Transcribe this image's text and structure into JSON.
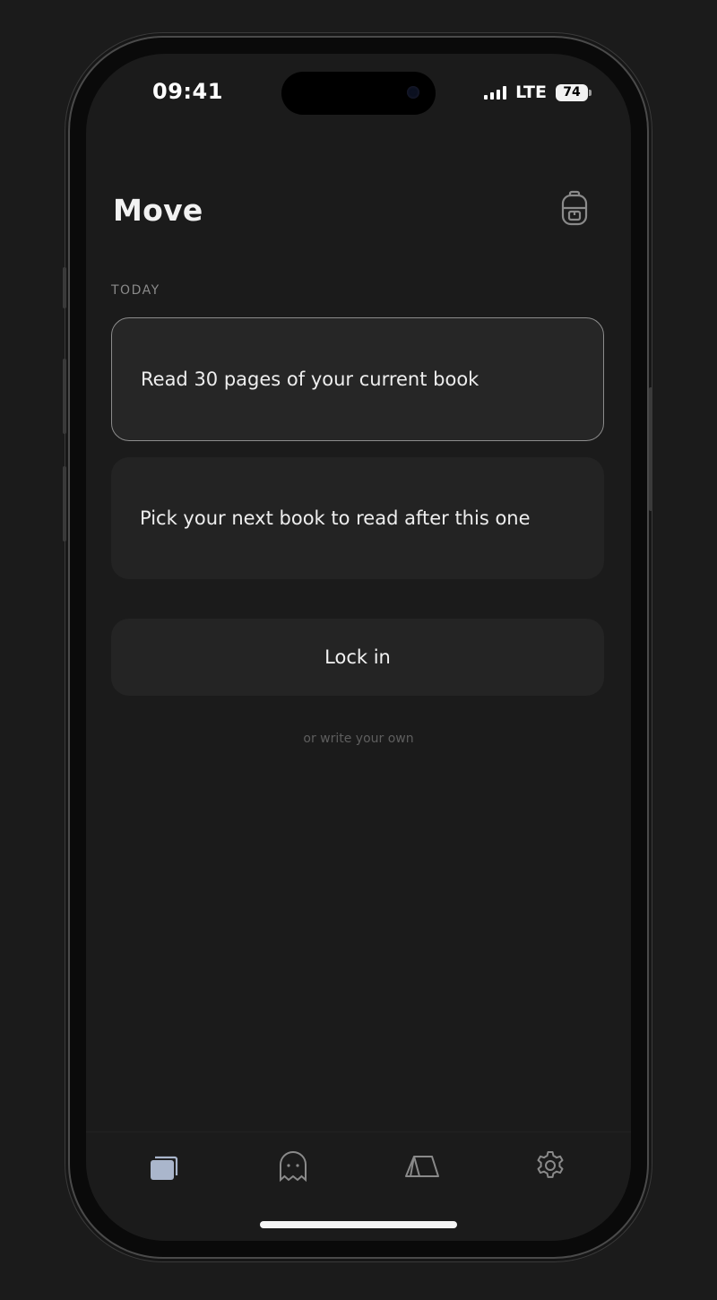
{
  "status_bar": {
    "time": "09:41",
    "network": "LTE",
    "battery": "74",
    "signal_bars": 4
  },
  "header": {
    "title": "Move",
    "backpack_icon": "backpack-icon"
  },
  "section": {
    "label": "TODAY"
  },
  "suggestions": [
    {
      "text": "Read 30 pages of your current book",
      "selected": true
    },
    {
      "text": "Pick your next book to read after this one",
      "selected": false
    }
  ],
  "actions": {
    "lock_in": "Lock in",
    "write_own": "or write your own"
  },
  "tabbar": {
    "tabs": [
      {
        "icon": "cards-icon",
        "active": true
      },
      {
        "icon": "ghost-icon",
        "active": false
      },
      {
        "icon": "tent-icon",
        "active": false
      },
      {
        "icon": "gear-icon",
        "active": false
      }
    ]
  },
  "colors": {
    "background": "#1b1b1b",
    "card": "#232323",
    "selected_border": "#8c8c8c",
    "active_tab": "#aab6cc",
    "inactive_tab": "#8a8a8a"
  }
}
